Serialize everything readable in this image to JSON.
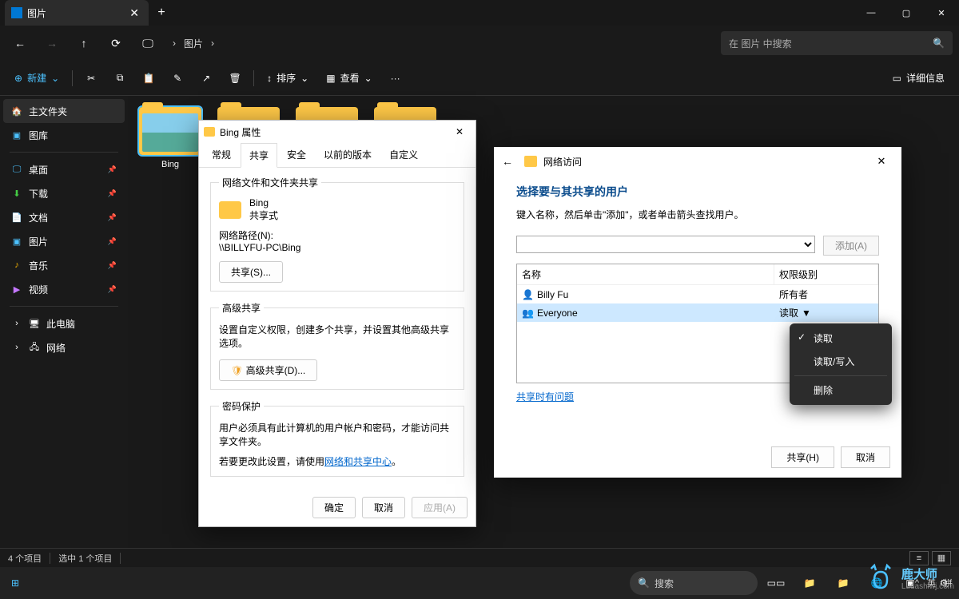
{
  "window": {
    "tab_title": "图片",
    "min": "—",
    "max": "▢",
    "close": "✕"
  },
  "addr": {
    "crumb": "图片",
    "search_placeholder": "在 图片 中搜索"
  },
  "toolbar": {
    "new": "新建",
    "sort": "排序",
    "view": "查看",
    "details": "详细信息",
    "more": "···"
  },
  "sidebar": {
    "home": "主文件夹",
    "gallery": "图库",
    "desktop": "桌面",
    "downloads": "下载",
    "documents": "文档",
    "pictures": "图片",
    "music": "音乐",
    "videos": "视频",
    "pc": "此电脑",
    "network": "网络"
  },
  "content": {
    "folder_selected": "Bing"
  },
  "properties": {
    "title": "Bing 属性",
    "tabs": {
      "general": "常规",
      "share": "共享",
      "security": "安全",
      "prev": "以前的版本",
      "custom": "自定义"
    },
    "section1": {
      "title": "网络文件和文件夹共享",
      "name": "Bing",
      "status": "共享式",
      "path_label": "网络路径(N):",
      "path": "\\\\BILLYFU-PC\\Bing",
      "btn": "共享(S)..."
    },
    "section2": {
      "title": "高级共享",
      "desc": "设置自定义权限，创建多个共享，并设置其他高级共享选项。",
      "btn": "高级共享(D)..."
    },
    "section3": {
      "title": "密码保护",
      "p1": "用户必须具有此计算机的用户帐户和密码，才能访问共享文件夹。",
      "p2a": "若要更改此设置，请使用",
      "link": "网络和共享中心",
      "p2b": "。"
    },
    "buttons": {
      "ok": "确定",
      "cancel": "取消",
      "apply": "应用(A)"
    }
  },
  "share": {
    "title": "网络访问",
    "heading": "选择要与其共享的用户",
    "hint": "键入名称，然后单击\"添加\"，或者单击箭头查找用户。",
    "add": "添加(A)",
    "col_name": "名称",
    "col_perm": "权限级别",
    "users": [
      {
        "name": "Billy Fu",
        "perm": "所有者"
      },
      {
        "name": "Everyone",
        "perm": "读取"
      }
    ],
    "help": "共享时有问题",
    "share_btn": "共享(H)",
    "cancel": "取消"
  },
  "menu": {
    "read": "读取",
    "readwrite": "读取/写入",
    "remove": "删除"
  },
  "status": {
    "count": "4 个项目",
    "sel": "选中 1 个项目"
  },
  "taskbar": {
    "search": "搜索",
    "ime_lang": "英",
    "ime_mode": "拼"
  },
  "watermark": {
    "brand": "鹿大师",
    "url": "Ludashiwj.com"
  }
}
